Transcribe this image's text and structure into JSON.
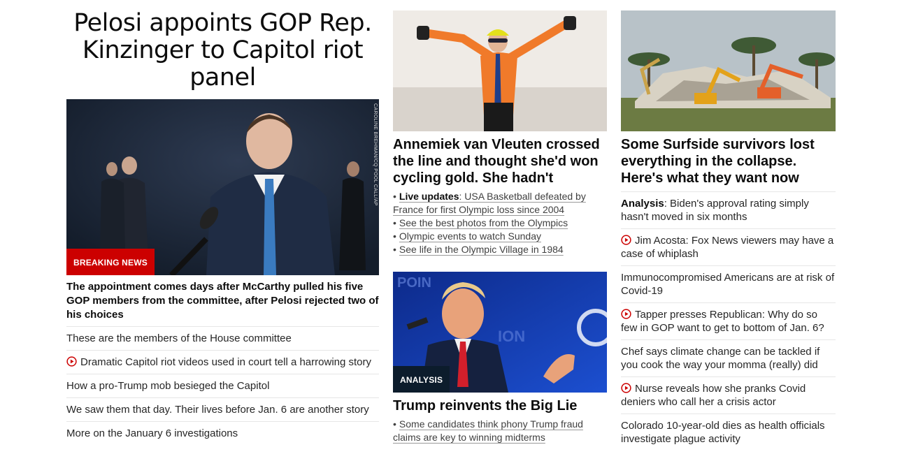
{
  "left": {
    "headline": "Pelosi appoints GOP Rep. Kinzinger to Capitol riot panel",
    "badge": "BREAKING NEWS",
    "photo_credit": "CAROLINE BREHMAN/CQ POOL CALL/AP",
    "subheadline": "The appointment comes days after McCarthy pulled his five GOP members from the committee, after Pelosi rejected two of his choices",
    "links": [
      {
        "text": "These are the members of the House committee",
        "video": false
      },
      {
        "text": "Dramatic Capitol riot videos used in court tell a harrowing story",
        "video": true
      },
      {
        "text": "How a pro-Trump mob besieged the Capitol",
        "video": false
      },
      {
        "text": "We saw them that day. Their lives before Jan. 6 are another story",
        "video": false
      },
      {
        "text": "More on the January 6 investigations",
        "video": false
      }
    ]
  },
  "middle": {
    "story1": {
      "title": "Annemiek van Vleuten crossed the line and thought she'd won cycling gold. She hadn't",
      "bullets": [
        {
          "bold": "Live updates",
          "text": ": USA Basketball defeated by France for first Olympic loss since 2004"
        },
        {
          "bold": "",
          "text": "See the best photos from the Olympics"
        },
        {
          "bold": "",
          "text": "Olympic events to watch Sunday"
        },
        {
          "bold": "",
          "text": "See life in the Olympic Village in 1984"
        }
      ]
    },
    "story2": {
      "badge": "ANALYSIS",
      "title": "Trump reinvents the Big Lie",
      "bullets": [
        {
          "bold": "",
          "text": "Some candidates think phony Trump fraud claims are key to winning midterms"
        }
      ]
    }
  },
  "right": {
    "title": "Some Surfside survivors lost everything in the collapse. Here's what they want now",
    "links": [
      {
        "bold": "Analysis",
        "text": ": Biden's approval rating simply hasn't moved in six months",
        "video": false
      },
      {
        "bold": "",
        "text": "Jim Acosta: Fox News viewers may have a case of whiplash",
        "video": true
      },
      {
        "bold": "",
        "text": "Immunocompromised Americans are at risk of Covid-19",
        "video": false
      },
      {
        "bold": "",
        "text": "Tapper presses Republican: Why do so few in GOP want to get to bottom of Jan. 6?",
        "video": true
      },
      {
        "bold": "",
        "text": "Chef says climate change can be tackled if you cook the way your momma (really) did",
        "video": false
      },
      {
        "bold": "",
        "text": "Nurse reveals how she pranks Covid deniers who call her a crisis actor",
        "video": true
      },
      {
        "bold": "",
        "text": "Colorado 10-year-old dies as health officials investigate plague activity",
        "video": false
      }
    ]
  },
  "icons": {
    "video": "play-circle-icon"
  },
  "colors": {
    "breaking": "#cc0000",
    "analysis_badge": "#0c1c2c",
    "play": "#cc0000"
  }
}
